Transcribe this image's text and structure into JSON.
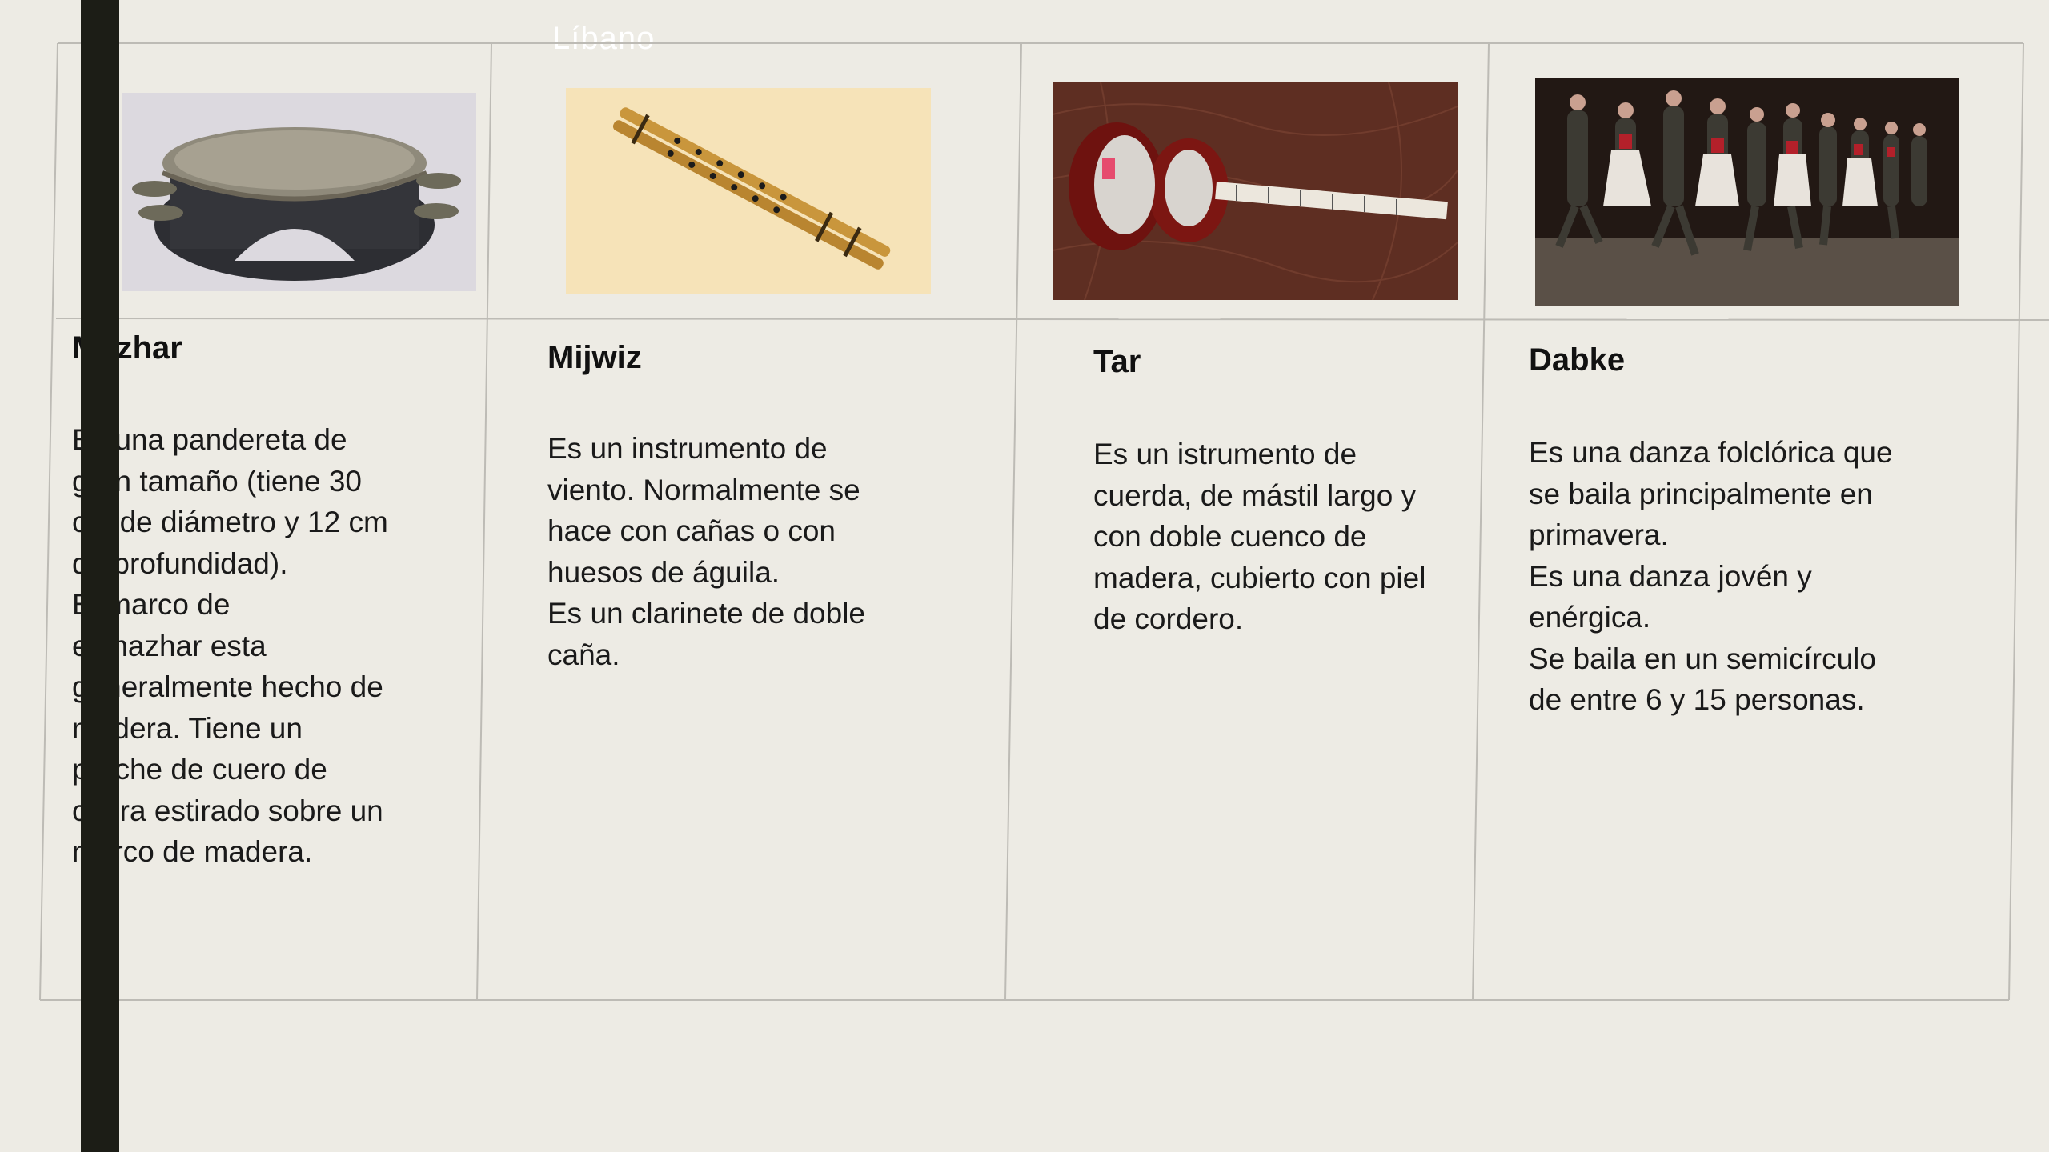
{
  "slide": {
    "title": "Líbano"
  },
  "columns": [
    {
      "title": "Mazhar",
      "image_subject": "mazhar-drum",
      "text": "Es una pandereta de\ngran tamaño (tiene 30\ncm de diámetro y 12 cm\nde profundidad).\nEl marco de\nel mazhar esta\ngeneralmente hecho de\nmadera. Tiene un\nparche de cuero de\ncabra estirado sobre un\nmarco de madera."
    },
    {
      "title": "Mijwiz",
      "image_subject": "mijwiz-flute",
      "text": "Es un instrumento de\nviento. Normalmente se\nhace con cañas o con\nhuesos de águila.\nEs un clarinete de doble\ncaña."
    },
    {
      "title": "Tar",
      "image_subject": "tar-lute",
      "text": "Es un istrumento de\ncuerda, de mástil largo y\ncon doble cuenco de\nmadera, cubierto con piel\nde cordero."
    },
    {
      "title": "Dabke",
      "image_subject": "dabke-dancers",
      "text": "Es una danza folclórica que\nse baila principalmente en\nprimavera.\nEs una danza jovén y\nenérgica.\nSe baila en un semicírculo\nde entre 6 y 15 personas."
    }
  ],
  "colors": {
    "background": "#edebe4",
    "grid_lines": "#bdbbb5",
    "side_bar": "#1c1d16",
    "title": "#ffffff"
  }
}
